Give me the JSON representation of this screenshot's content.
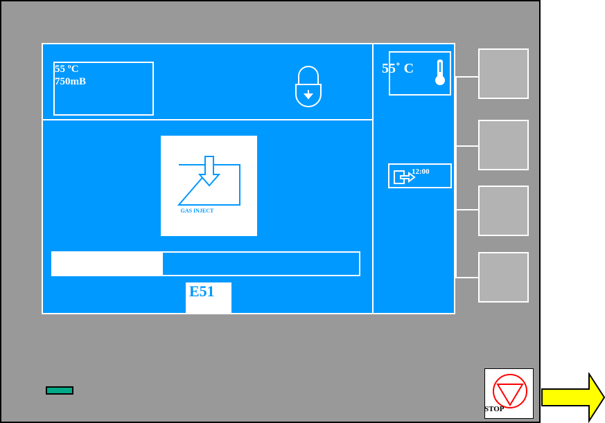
{
  "status": {
    "temperature": "55 ºC",
    "pressure": "750mB"
  },
  "temperature_display": {
    "value": "55˚ C"
  },
  "timer": {
    "value": "12:00"
  },
  "process": {
    "label": "GAS INJECT"
  },
  "progress": {
    "fraction": 0.36
  },
  "error": {
    "code": "E51"
  },
  "stop_button": {
    "label": "STOP"
  },
  "icons": [
    "lock-icon",
    "thermometer-icon",
    "exit-icon",
    "gas-inject-icon",
    "stop-icon",
    "arrow-right-icon"
  ],
  "colors": {
    "screen": "#0099ff",
    "panel": "#999999",
    "softkey": "#b3b3b3",
    "led": "#00aa88",
    "stop": "#ff0000",
    "arrow": "#ffff00"
  }
}
